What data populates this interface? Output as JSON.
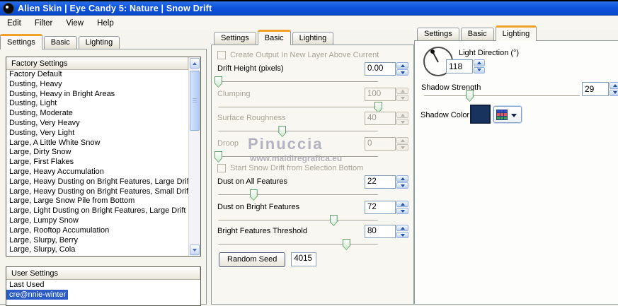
{
  "window": {
    "title": "Alien Skin | Eye Candy 5: Nature | Snow Drift",
    "menu": [
      "Edit",
      "Filter",
      "View",
      "Help"
    ]
  },
  "tabs": {
    "settings": "Settings",
    "basic": "Basic",
    "lighting": "Lighting"
  },
  "left": {
    "factory": {
      "header": "Factory Settings",
      "items": [
        "Factory Default",
        "Dusting, Heavy",
        "Dusting, Heavy in Bright Areas",
        "Dusting, Light",
        "Dusting, Moderate",
        "Dusting, Very Heavy",
        "Dusting, Very Light",
        "Large, A Little White Snow",
        "Large, Dirty Snow",
        "Large, First Flakes",
        "Large, Heavy Accumulation",
        "Large, Heavy Dusting on Bright Features, Large Drift",
        "Large, Heavy Dusting on Bright Features, Small Drift",
        "Large, Large Snow Pile from Bottom",
        "Large, Light Dusting on Bright Features, Large Drift",
        "Large, Lumpy Snow",
        "Large, Rooftop Accumulation",
        "Large, Slurpy, Berry",
        "Large, Slurpy, Cola"
      ]
    },
    "user": {
      "header": "User Settings",
      "items": [
        {
          "label": "Last Used",
          "selected": false
        },
        {
          "label": "cre@nnie-winter",
          "selected": true
        }
      ]
    }
  },
  "basic": {
    "checkbox_new_layer": "Create Output In New Layer Above Current",
    "drift": {
      "label": "Drift Height (pixels)",
      "value": "0.00",
      "percent": 0,
      "enabled": true
    },
    "clumping": {
      "label": "Clumping",
      "value": "100",
      "percent": 100,
      "enabled": false
    },
    "surface": {
      "label": "Surface Roughness",
      "value": "40",
      "percent": 40,
      "enabled": false
    },
    "droop": {
      "label": "Droop",
      "value": "0",
      "percent": 0,
      "enabled": false
    },
    "checkbox_start_bottom": "Start Snow Drift from Selection Bottom",
    "dust_all": {
      "label": "Dust on All Features",
      "value": "22",
      "percent": 22,
      "enabled": true
    },
    "dust_bright": {
      "label": "Dust on Bright Features",
      "value": "72",
      "percent": 72,
      "enabled": true
    },
    "threshold": {
      "label": "Bright Features Threshold",
      "value": "80",
      "percent": 80,
      "enabled": true
    },
    "random_seed": {
      "button": "Random Seed",
      "value": "4015"
    }
  },
  "lighting": {
    "light_direction": {
      "label": "Light Direction (°)",
      "value": "118",
      "degrees": 118
    },
    "shadow_strength": {
      "label": "Shadow Strength",
      "value": "29",
      "percent": 29
    },
    "shadow_color": {
      "label": "Shadow Color",
      "hex": "#17335e"
    }
  },
  "watermark": {
    "line1": "Pinuccia",
    "line2": "www.maidiregrafica.eu"
  },
  "colors": {
    "titlebar_blue": "#0f55dd",
    "active_tab_accent": "#f0a12a",
    "selection_blue": "#2b5bc7",
    "shadow_swatch": "#17335e"
  }
}
